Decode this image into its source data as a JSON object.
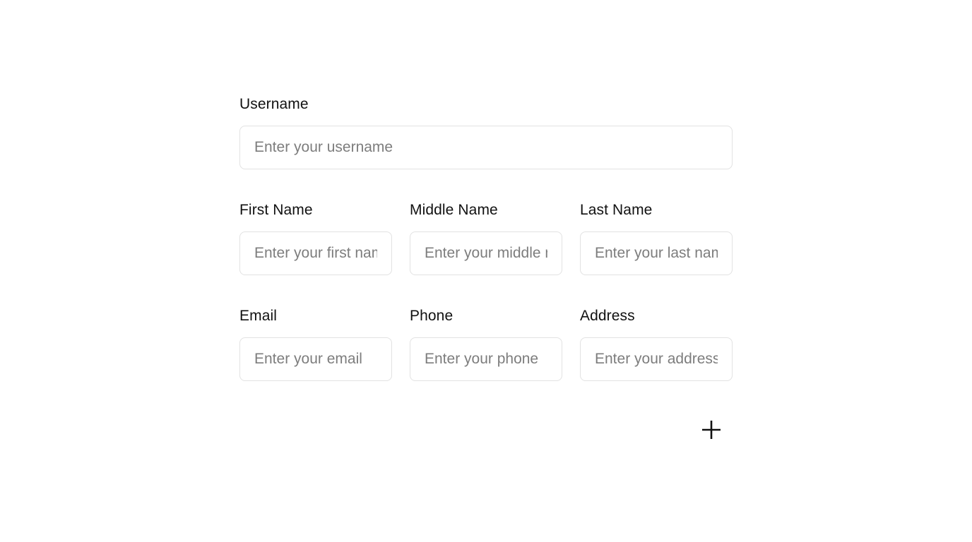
{
  "form": {
    "username": {
      "label": "Username",
      "placeholder": "Enter your username",
      "value": ""
    },
    "name_row": [
      {
        "label": "First Name",
        "placeholder": "Enter your first name",
        "value": ""
      },
      {
        "label": "Middle Name",
        "placeholder": "Enter your middle name",
        "value": ""
      },
      {
        "label": "Last Name",
        "placeholder": "Enter your last name",
        "value": ""
      }
    ],
    "contact_row": [
      {
        "label": "Email",
        "placeholder": "Enter your email",
        "value": ""
      },
      {
        "label": "Phone",
        "placeholder": "Enter your phone",
        "value": ""
      },
      {
        "label": "Address",
        "placeholder": "Enter your address",
        "value": ""
      }
    ]
  },
  "actions": {
    "add_icon": "plus-icon"
  },
  "colors": {
    "background": "#ffffff",
    "text": "#111111",
    "placeholder": "#7d7d7d",
    "border": "#e2e2e2"
  }
}
